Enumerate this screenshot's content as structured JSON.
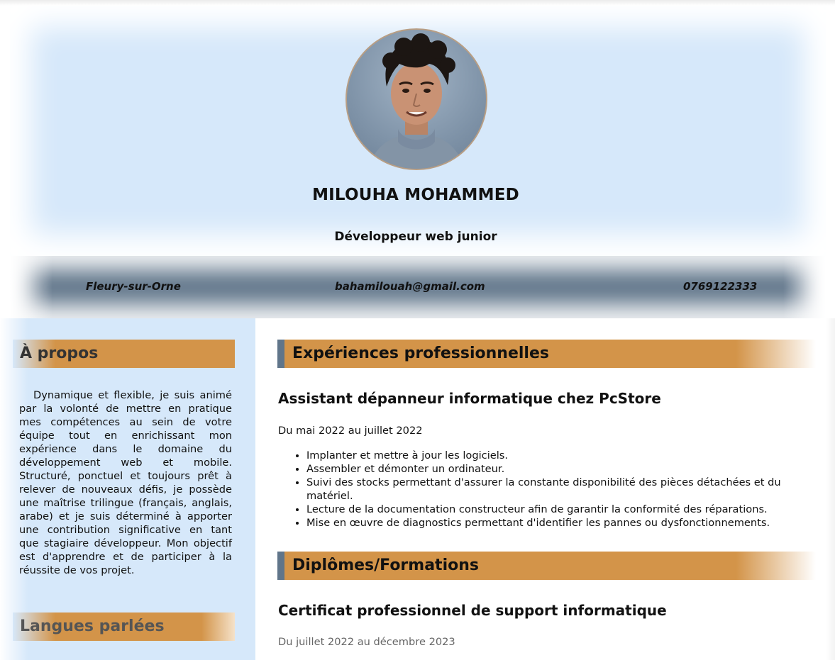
{
  "profile": {
    "name": "MILOUHA MOHAMMED",
    "job_title": "Développeur web junior",
    "photo_icon": "profile-photo"
  },
  "contact": {
    "city": "Fleury-sur-Orne",
    "email": "bahamilouah@gmail.com",
    "phone": "0769122333"
  },
  "sidebar": {
    "about_heading": "À propos",
    "about_text": "Dynamique et flexible, je suis animé par la volonté de mettre en pratique mes compétences au sein de votre équipe tout en enrichissant mon expérience dans le domaine du développement web et mobile. Structuré, ponctuel et toujours prêt à relever de nouveaux défis, je possède une maîtrise trilingue (français, anglais, arabe) et je suis déterminé à apporter une contribution significative en tant que stagiaire développeur. Mon objectif est d'apprendre et de participer à la réussite de vos projet.",
    "languages_heading": "Langues parlées"
  },
  "experience": {
    "heading": "Expériences professionnelles",
    "items": [
      {
        "title": "Assistant dépanneur informatique chez PcStore",
        "dates": "Du mai 2022 au juillet 2022",
        "tasks": [
          "Implanter et mettre à jour les logiciels.",
          "Assembler et démonter un ordinateur.",
          "Suivi des stocks permettant d'assurer la constante disponibilité des pièces détachées et du matériel.",
          "Lecture de la documentation constructeur afin de garantir la conformité des réparations.",
          "Mise en œuvre de diagnostics permettant d'identifier les pannes ou dysfonctionnements."
        ]
      }
    ]
  },
  "education": {
    "heading": "Diplômes/Formations",
    "items": [
      {
        "title": "Certificat professionnel de support informatique",
        "dates": "Du juillet 2022 au décembre 2023"
      }
    ]
  },
  "colors": {
    "header_bg": "#d6e8fa",
    "contact_bar": "#60758a",
    "accent": "#d39449"
  }
}
